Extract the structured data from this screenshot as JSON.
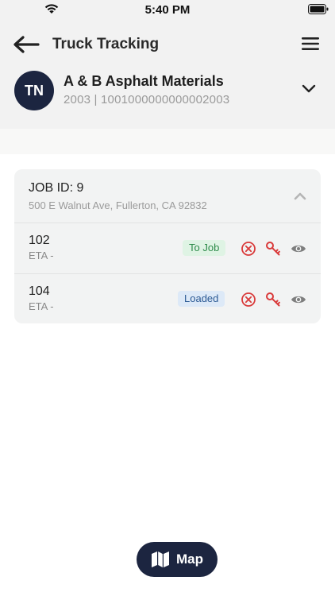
{
  "status_bar": {
    "time": "5:40 PM"
  },
  "header": {
    "title": "Truck Tracking"
  },
  "company": {
    "initials": "TN",
    "name": "A & B Asphalt Materials",
    "subtitle": "2003 | 1001000000000002003"
  },
  "job": {
    "title": "JOB ID: 9",
    "address": "500 E Walnut Ave, Fullerton, CA 92832",
    "trucks": [
      {
        "id": "102",
        "eta": "ETA -",
        "status": "To Job"
      },
      {
        "id": "104",
        "eta": "ETA -",
        "status": "Loaded"
      }
    ]
  },
  "map_button": {
    "label": "Map"
  },
  "colors": {
    "navy": "#1c2540",
    "danger": "#d93a3a",
    "to_job_bg": "#dff3e4",
    "to_job_text": "#2e8b4a",
    "loaded_bg": "#dde9f7",
    "loaded_text": "#2c5a94"
  },
  "icons": [
    "wifi-icon",
    "battery-icon",
    "back-arrow-icon",
    "menu-icon",
    "chevron-down-icon",
    "chevron-up-icon",
    "cancel-circle-icon",
    "key-icon",
    "eye-icon",
    "map-icon"
  ]
}
